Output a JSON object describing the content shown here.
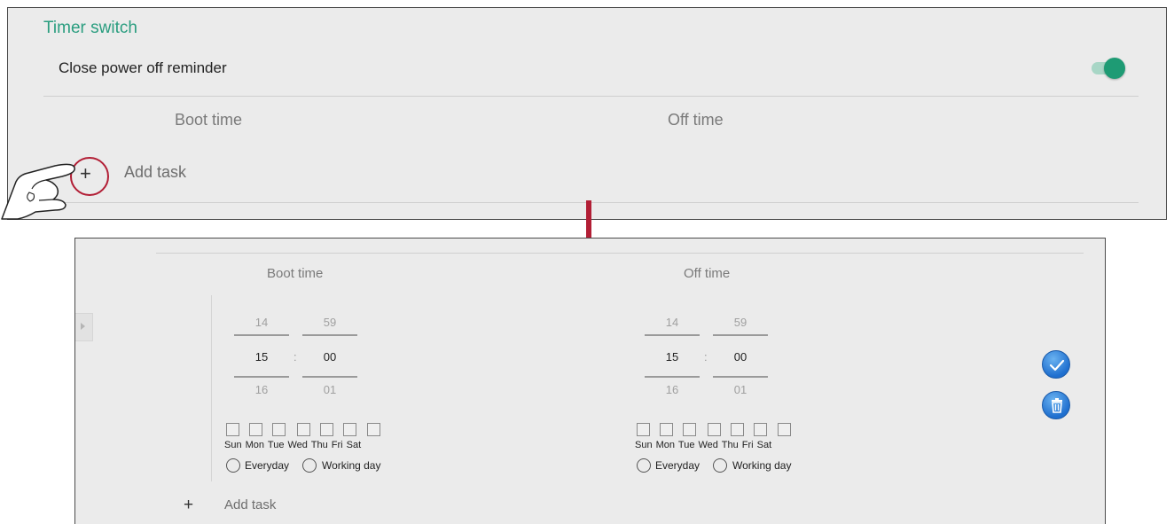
{
  "top_panel": {
    "title": "Timer switch",
    "reminder_label": "Close power off reminder",
    "reminder_enabled": true,
    "boot_time_header": "Boot time",
    "off_time_header": "Off time",
    "add_task_label": "Add task",
    "add_icon": "+"
  },
  "bottom_panel": {
    "boot_time_header": "Boot time",
    "off_time_header": "Off time",
    "boot": {
      "hour_prev": "14",
      "hour": "15",
      "hour_next": "16",
      "min_prev": "59",
      "min": "00",
      "min_next": "01",
      "separator": ":",
      "days_label": "Sun Mon Tue Wed Thu Fri  Sat",
      "everyday": "Everyday",
      "working_day": "Working day"
    },
    "off": {
      "hour_prev": "14",
      "hour": "15",
      "hour_next": "16",
      "min_prev": "59",
      "min": "00",
      "min_next": "01",
      "separator": ":",
      "days_label": "Sun Mon Tue Wed Thu Fri  Sat",
      "everyday": "Everyday",
      "working_day": "Working day"
    },
    "add_task_label": "Add task",
    "add_icon": "+"
  },
  "colors": {
    "accent_green": "#2a9d7f",
    "highlight_red": "#b21e35",
    "button_blue": "#1f6fcf"
  },
  "icons": [
    "toggle-switch-icon",
    "plus-icon",
    "pointing-hand-icon",
    "arrow-down-icon",
    "check-icon",
    "trash-icon",
    "side-expand-icon"
  ]
}
